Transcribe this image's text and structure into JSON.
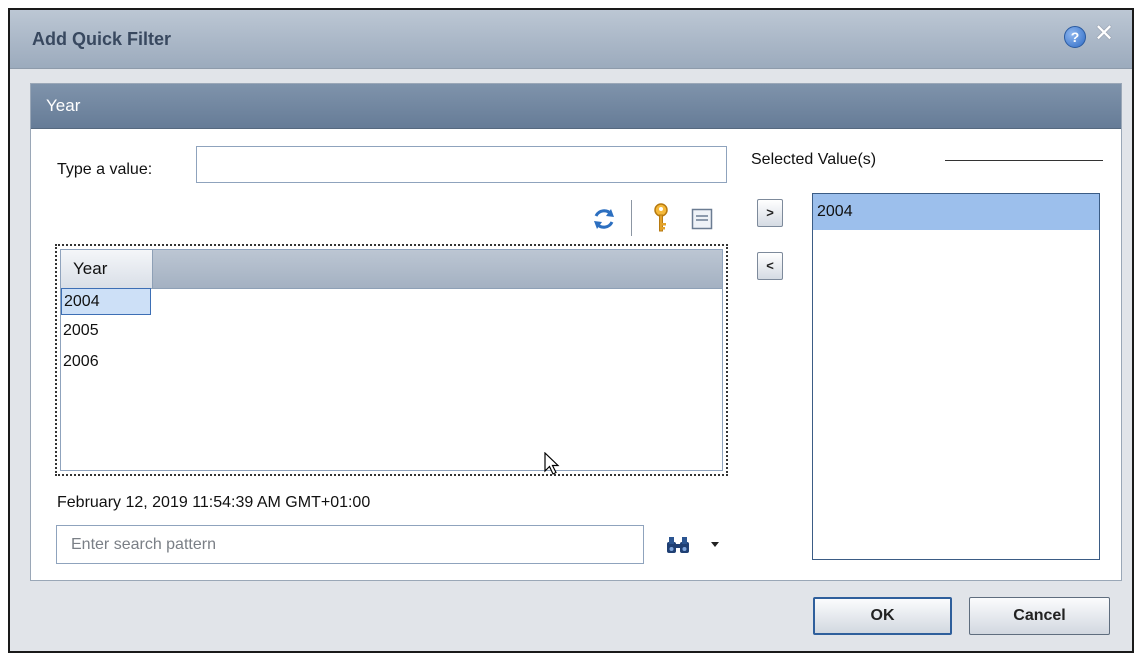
{
  "dialog": {
    "title": "Add Quick Filter",
    "help_icon": "question-circle-icon",
    "close_icon": "close-icon"
  },
  "panel": {
    "header": "Year",
    "type_value_label": "Type a value:",
    "type_value_input": "",
    "toolbar_icons": [
      "refresh-icon",
      "key-icon",
      "collapse-icon"
    ],
    "grid": {
      "column_header": "Year",
      "rows": [
        "2004",
        "2005",
        "2006"
      ],
      "selected_row": "2004"
    },
    "timestamp": "February 12, 2019 11:54:39 AM GMT+01:00",
    "search": {
      "placeholder": "Enter search pattern",
      "icon": "binoculars-icon"
    },
    "add_button": ">",
    "remove_button": "<",
    "selected_values_label": "Selected Value(s)",
    "selected_values": [
      "2004"
    ]
  },
  "footer": {
    "ok_label": "OK",
    "cancel_label": "Cancel"
  },
  "colors": {
    "title_bar": "#aab7c7",
    "panel_header": "#6f849f",
    "selection": "#9cbfec"
  }
}
